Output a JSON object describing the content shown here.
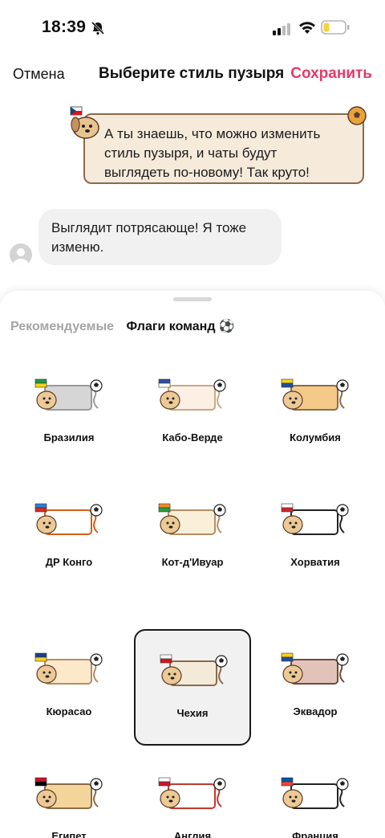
{
  "status": {
    "time": "18:39"
  },
  "nav": {
    "cancel": "Отмена",
    "title": "Выберите стиль пузыря",
    "save": "Сохранить"
  },
  "preview": {
    "outgoing_lines": [
      "А ты знаешь, что можно изменить",
      "стиль пузыря, и чаты будут",
      "выглядеть по-новому! Так круто!"
    ],
    "incoming_lines": [
      "Выглядит потрясающе! Я тоже",
      "изменю."
    ]
  },
  "tabs": [
    {
      "label": "Рекомендуемые",
      "active": false
    },
    {
      "label": "Флаги команд ⚽",
      "active": true
    }
  ],
  "styles": [
    {
      "label": "Бразилия",
      "bubble": "#d6d6d6",
      "border": "#9a9a9a",
      "selected": false
    },
    {
      "label": "Кабо-Верде",
      "bubble": "#fbf0e3",
      "border": "#c9a885",
      "selected": false
    },
    {
      "label": "Колумбия",
      "bubble": "#f5c987",
      "border": "#8b6a4a",
      "selected": false
    },
    {
      "label": "ДР Конго",
      "bubble": "#ffffff",
      "border": "#d2601d",
      "selected": false
    },
    {
      "label": "Кот-д'Ивуар",
      "bubble": "#faefd9",
      "border": "#b48e66",
      "selected": false
    },
    {
      "label": "Хорватия",
      "bubble": "#ffffff",
      "border": "#222222",
      "selected": false
    },
    {
      "label": "Кюрасао",
      "bubble": "#fde8c9",
      "border": "#b48e66",
      "selected": false
    },
    {
      "label": "Чехия",
      "bubble": "#f4ead9",
      "border": "#8b6a4a",
      "selected": true
    },
    {
      "label": "Эквадор",
      "bubble": "#e2c3b9",
      "border": "#6f4a3a",
      "selected": false
    },
    {
      "label": "Египет",
      "bubble": "#f3d59b",
      "border": "#8b6a4a",
      "selected": false
    },
    {
      "label": "Англия",
      "bubble": "#ffffff",
      "border": "#c0392b",
      "selected": false
    },
    {
      "label": "Франция",
      "bubble": "#ffffff",
      "border": "#222222",
      "selected": false
    }
  ]
}
